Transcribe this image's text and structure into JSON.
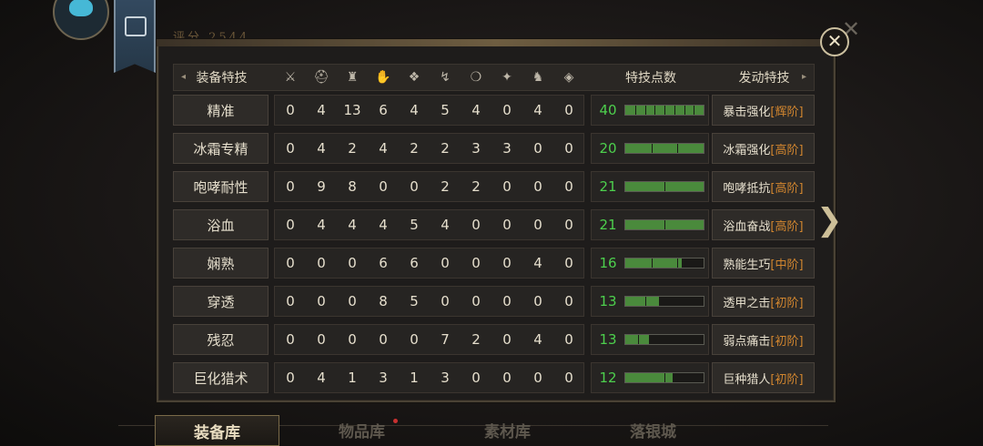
{
  "score": "评分 2544",
  "close_icon": "close-icon",
  "header": {
    "name_label": "装备特技",
    "points_label": "特技点数",
    "skill_label": "发动特技",
    "icons": [
      "weapon-icon",
      "helmet-icon",
      "chest-icon",
      "arm-icon",
      "waist-icon",
      "leg-icon",
      "charm-icon",
      "decoration-icon",
      "palico-icon",
      "amulet-icon"
    ]
  },
  "rows": [
    {
      "name": "精准",
      "values": [
        "0",
        "4",
        "13",
        "6",
        "4",
        "5",
        "4",
        "0",
        "4",
        "0"
      ],
      "points": "40",
      "fill": 1.0,
      "segments": 8,
      "skill": "暴击强化",
      "rank": "[辉阶]"
    },
    {
      "name": "冰霜专精",
      "values": [
        "0",
        "4",
        "2",
        "4",
        "2",
        "2",
        "3",
        "3",
        "0",
        "0"
      ],
      "points": "20",
      "fill": 1.0,
      "segments": 3,
      "skill": "冰霜强化",
      "rank": "[高阶]"
    },
    {
      "name": "咆哮耐性",
      "values": [
        "0",
        "9",
        "8",
        "0",
        "0",
        "2",
        "2",
        "0",
        "0",
        "0"
      ],
      "points": "21",
      "fill": 1.0,
      "segments": 2,
      "skill": "咆哮抵抗",
      "rank": "[高阶]"
    },
    {
      "name": "浴血",
      "values": [
        "0",
        "4",
        "4",
        "4",
        "5",
        "4",
        "0",
        "0",
        "0",
        "0"
      ],
      "points": "21",
      "fill": 1.0,
      "segments": 2,
      "skill": "浴血奋战",
      "rank": "[高阶]"
    },
    {
      "name": "娴熟",
      "values": [
        "0",
        "0",
        "0",
        "6",
        "6",
        "0",
        "0",
        "0",
        "4",
        "0"
      ],
      "points": "16",
      "fill": 0.72,
      "segments": 3,
      "skill": "熟能生巧",
      "rank": "[中阶]"
    },
    {
      "name": "穿透",
      "values": [
        "0",
        "0",
        "0",
        "8",
        "5",
        "0",
        "0",
        "0",
        "0",
        "0"
      ],
      "points": "13",
      "fill": 0.43,
      "segments": 4,
      "skill": "透甲之击",
      "rank": "[初阶]"
    },
    {
      "name": "残忍",
      "values": [
        "0",
        "0",
        "0",
        "0",
        "0",
        "7",
        "2",
        "0",
        "4",
        "0"
      ],
      "points": "13",
      "fill": 0.3,
      "segments": 6,
      "skill": "弱点痛击",
      "rank": "[初阶]"
    },
    {
      "name": "巨化猎术",
      "values": [
        "0",
        "4",
        "1",
        "3",
        "1",
        "3",
        "0",
        "0",
        "0",
        "0"
      ],
      "points": "12",
      "fill": 0.6,
      "segments": 2,
      "skill": "巨种猎人",
      "rank": "[初阶]"
    }
  ],
  "tabs": [
    {
      "label": "装备库",
      "active": true
    },
    {
      "label": "物品库",
      "active": false,
      "dot": true
    },
    {
      "label": "素材库",
      "active": false
    },
    {
      "label": "落银城",
      "active": false
    }
  ]
}
